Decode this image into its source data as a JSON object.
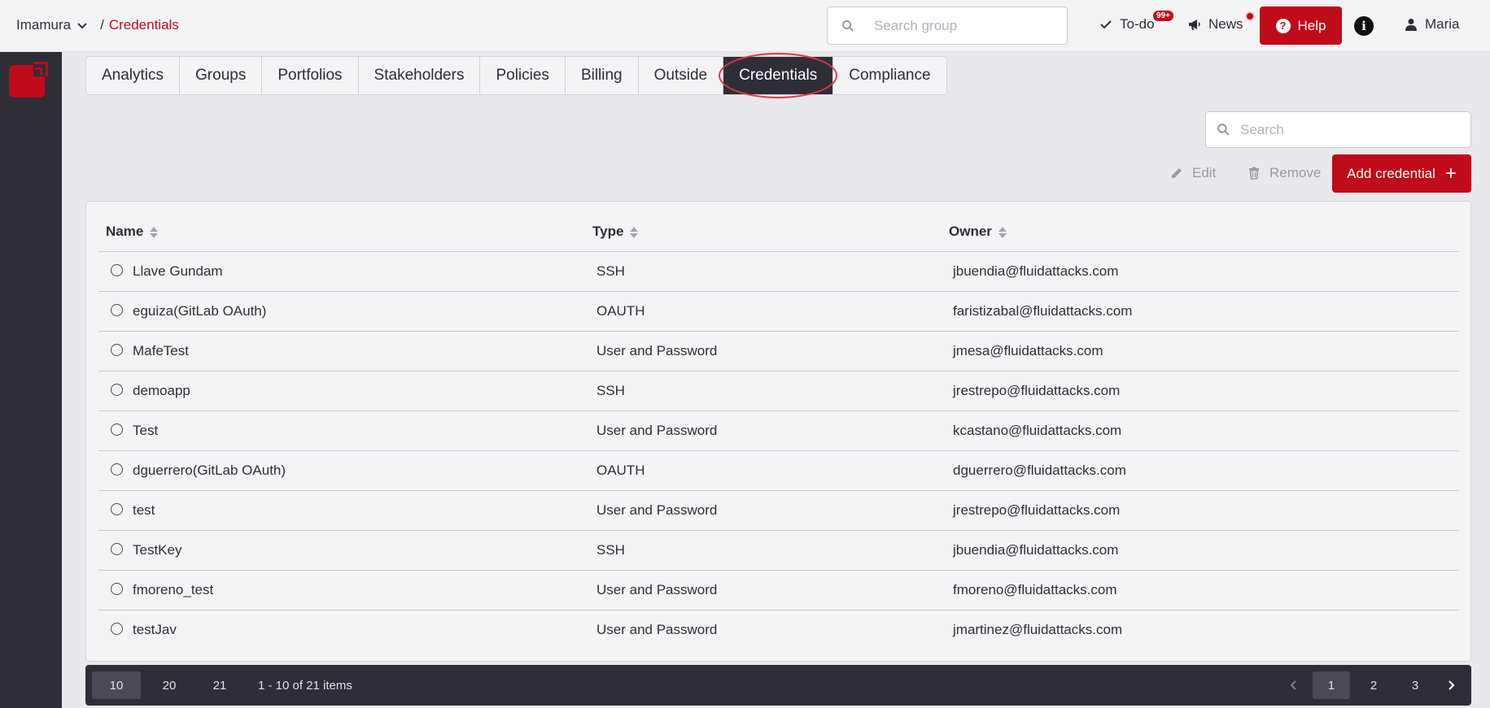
{
  "breadcrumb": {
    "org": "Imamura",
    "separator": "/",
    "current": "Credentials"
  },
  "topbar": {
    "search_placeholder": "Search group",
    "todo_label": "To-do",
    "todo_badge": "99+",
    "news_label": "News",
    "help_label": "Help",
    "info_glyph": "i",
    "user_name": "Maria"
  },
  "tabs": [
    {
      "label": "Analytics"
    },
    {
      "label": "Groups"
    },
    {
      "label": "Portfolios"
    },
    {
      "label": "Stakeholders"
    },
    {
      "label": "Policies"
    },
    {
      "label": "Billing"
    },
    {
      "label": "Outside"
    },
    {
      "label": "Credentials"
    },
    {
      "label": "Compliance"
    }
  ],
  "toolbar": {
    "search_placeholder": "Search",
    "edit_label": "Edit",
    "remove_label": "Remove",
    "add_label": "Add credential",
    "add_glyph": "+"
  },
  "table": {
    "headers": {
      "name": "Name",
      "type": "Type",
      "owner": "Owner"
    },
    "rows": [
      {
        "name": "Llave Gundam",
        "type": "SSH",
        "owner": "jbuendia@fluidattacks.com"
      },
      {
        "name": "eguiza(GitLab OAuth)",
        "type": "OAUTH",
        "owner": "faristizabal@fluidattacks.com"
      },
      {
        "name": "MafeTest",
        "type": "User and Password",
        "owner": "jmesa@fluidattacks.com"
      },
      {
        "name": "demoapp",
        "type": "SSH",
        "owner": "jrestrepo@fluidattacks.com"
      },
      {
        "name": "Test",
        "type": "User and Password",
        "owner": "kcastano@fluidattacks.com"
      },
      {
        "name": "dguerrero(GitLab OAuth)",
        "type": "OAUTH",
        "owner": "dguerrero@fluidattacks.com"
      },
      {
        "name": "test",
        "type": "User and Password",
        "owner": "jrestrepo@fluidattacks.com"
      },
      {
        "name": "TestKey",
        "type": "SSH",
        "owner": "jbuendia@fluidattacks.com"
      },
      {
        "name": "fmoreno_test",
        "type": "User and Password",
        "owner": "fmoreno@fluidattacks.com"
      },
      {
        "name": "testJav",
        "type": "User and Password",
        "owner": "jmartinez@fluidattacks.com"
      }
    ]
  },
  "pagination": {
    "sizes": [
      "10",
      "20",
      "21"
    ],
    "range_text": "1 - 10 of 21 items",
    "pages": [
      "1",
      "2",
      "3"
    ]
  },
  "colors": {
    "brand": "#bf0b1a",
    "dark": "#2e2e38",
    "background": "#e9e9ed"
  }
}
